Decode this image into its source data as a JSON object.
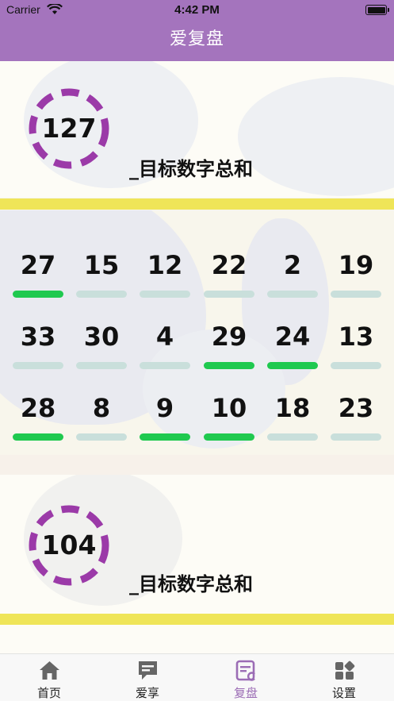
{
  "status": {
    "carrier": "Carrier",
    "time": "4:42 PM"
  },
  "nav": {
    "title": "爱复盘"
  },
  "cards": [
    {
      "target": "127",
      "label": "_目标数字总和"
    },
    {
      "target": "104",
      "label": "_目标数字总和"
    }
  ],
  "grid": {
    "rows": [
      [
        {
          "value": "27",
          "selected": true
        },
        {
          "value": "15",
          "selected": false
        },
        {
          "value": "12",
          "selected": false
        },
        {
          "value": "22",
          "selected": false
        },
        {
          "value": "2",
          "selected": false
        },
        {
          "value": "19",
          "selected": false
        }
      ],
      [
        {
          "value": "33",
          "selected": false
        },
        {
          "value": "30",
          "selected": false
        },
        {
          "value": "4",
          "selected": false
        },
        {
          "value": "29",
          "selected": true
        },
        {
          "value": "24",
          "selected": true
        },
        {
          "value": "13",
          "selected": false
        }
      ],
      [
        {
          "value": "28",
          "selected": true
        },
        {
          "value": "8",
          "selected": false
        },
        {
          "value": "9",
          "selected": true
        },
        {
          "value": "10",
          "selected": true
        },
        {
          "value": "18",
          "selected": false
        },
        {
          "value": "23",
          "selected": false
        }
      ]
    ]
  },
  "colors": {
    "brand": "#a474bd",
    "ring": "#9b3aa8",
    "selected": "#1fc94f",
    "unselected": "#c9dfdb",
    "accent_yellow": "#efe558",
    "tab_active": "#9b6cb5"
  },
  "tabs": [
    {
      "label": "首页",
      "icon": "home-icon",
      "active": false
    },
    {
      "label": "爱享",
      "icon": "chat-icon",
      "active": false
    },
    {
      "label": "复盘",
      "icon": "review-icon",
      "active": true
    },
    {
      "label": "设置",
      "icon": "settings-grid-icon",
      "active": false
    }
  ]
}
